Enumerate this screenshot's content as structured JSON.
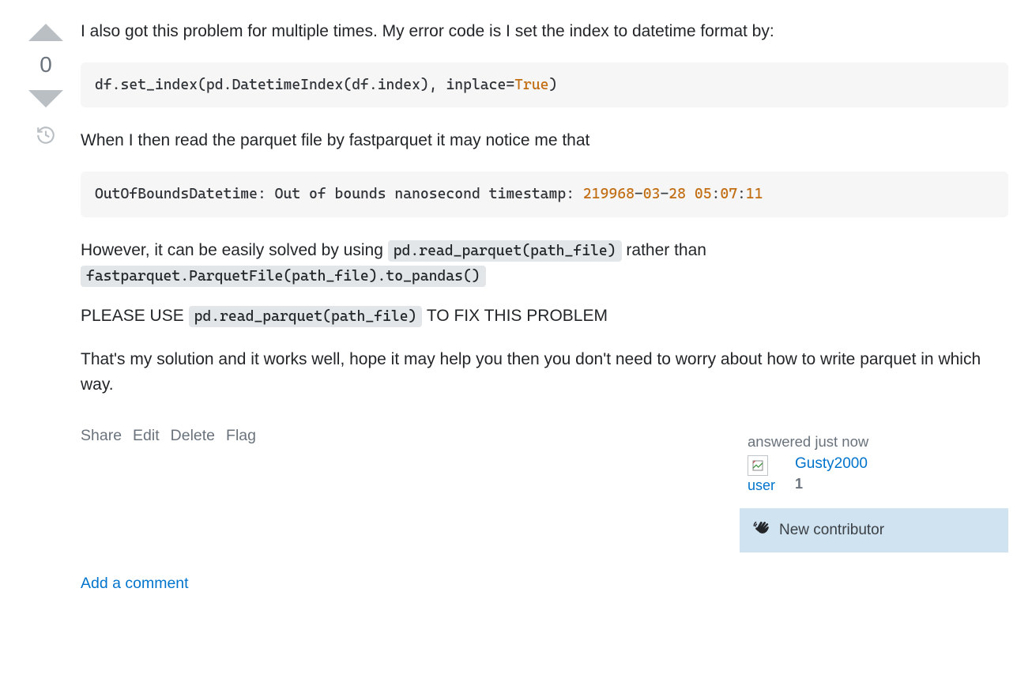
{
  "vote": {
    "count": "0"
  },
  "post": {
    "p1": "I also got this problem for multiple times. My error code is I set the index to datetime format by:",
    "code1_pre": "df.set_index(pd.DatetimeIndex(df.index), inplace=",
    "code1_kw": "True",
    "code1_post": ")",
    "p2": "When I then read the parquet file by fastparquet it may notice me that",
    "code2_a": "OutOfBoundsDatetime: Out of bounds nanosecond timestamp: ",
    "code2_num1": "219968",
    "code2_dash1": "-",
    "code2_num2": "03",
    "code2_dash2": "-",
    "code2_num3": "28",
    "code2_sp": " ",
    "code2_num4": "05",
    "code2_colon1": ":",
    "code2_num5": "07",
    "code2_colon2": ":",
    "code2_num6": "11",
    "p3_a": "However, it can be easily solved by using ",
    "p3_code1": "pd.read_parquet(path_file)",
    "p3_b": " rather than ",
    "p3_code2": "fastparquet.ParquetFile(path_file).to_pandas()",
    "p4_a": "PLEASE USE ",
    "p4_code": "pd.read_parquet(path_file)",
    "p4_b": " TO FIX THIS PROBLEM",
    "p5": "That's my solution and it works well, hope it may help you then you don't need to worry about how to write parquet in which way."
  },
  "actions": {
    "share": "Share",
    "edit": "Edit",
    "delete": "Delete",
    "flag": "Flag"
  },
  "userCard": {
    "answered": "answered just now",
    "avatarAlt": "user",
    "userName": "Gusty2000",
    "reputation": "1",
    "newContributor": "New contributor"
  },
  "comment": {
    "add": "Add a comment"
  }
}
